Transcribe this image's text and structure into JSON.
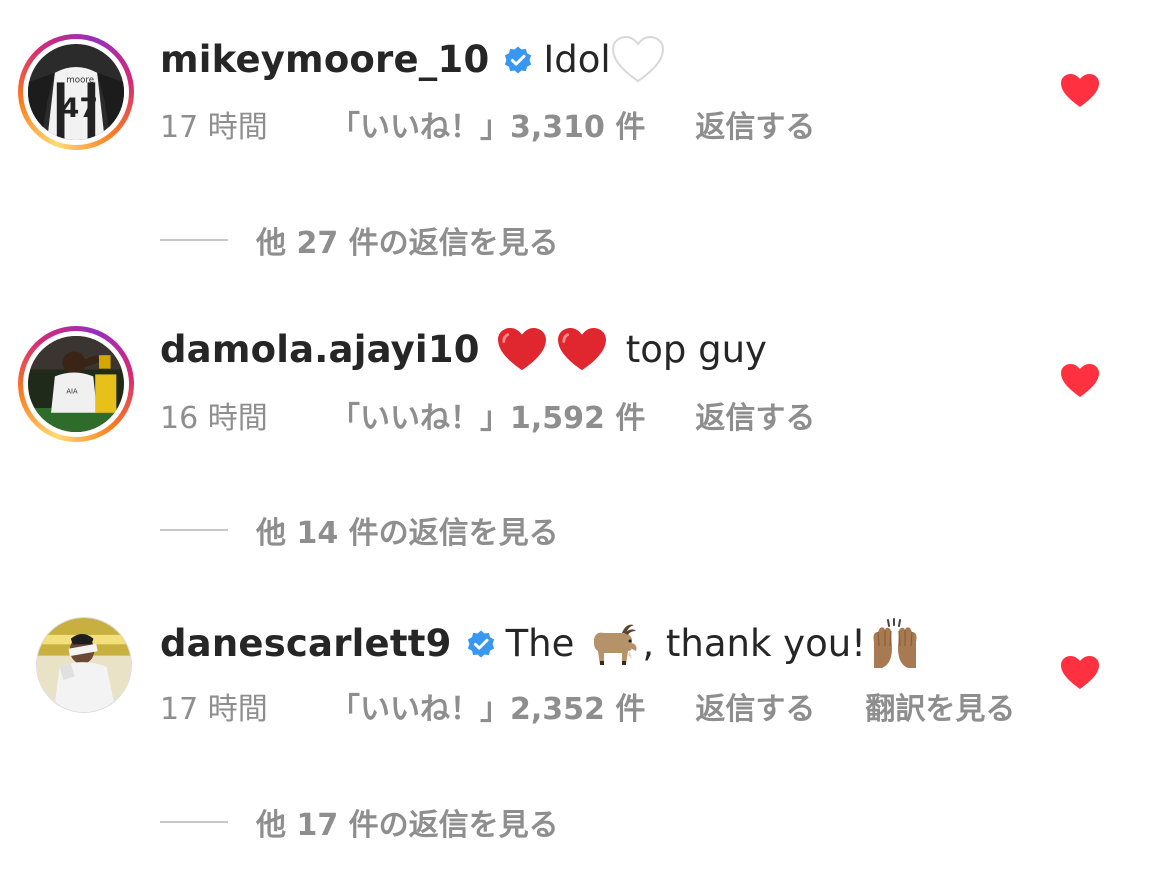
{
  "comments": [
    {
      "username": "mikeymoore_10",
      "verified": true,
      "text": "Idol",
      "emoji": "white-heart",
      "time": "17 時間",
      "likes": "「いいね！」3,310 件",
      "reply_label": "返信する",
      "liked": true,
      "more_replies": "他 27 件の返信を見る",
      "avatar": "avatar-mikeymoore"
    },
    {
      "username": "damola.ajayi10",
      "verified": false,
      "text": "top guy",
      "emoji": "red-heart-x2",
      "time": "16 時間",
      "likes": "「いいね！」1,592 件",
      "reply_label": "返信する",
      "liked": true,
      "more_replies": "他 14 件の返信を見る",
      "avatar": "avatar-damola"
    },
    {
      "username": "danescarlett9",
      "verified": true,
      "text_before": "The",
      "text_after": ", thank you!",
      "emoji": "goat",
      "emoji2": "raising-hands",
      "time": "17 時間",
      "likes": "「いいね！」2,352 件",
      "reply_label": "返信する",
      "translate_label": "翻訳を見る",
      "liked": true,
      "more_replies": "他 17 件の返信を見る",
      "avatar": "avatar-danescarlett"
    }
  ],
  "colors": {
    "like_red": "#ff3040",
    "verified_blue": "#3897f0",
    "meta_gray": "#8e8e8e",
    "text_dark": "#262626"
  }
}
